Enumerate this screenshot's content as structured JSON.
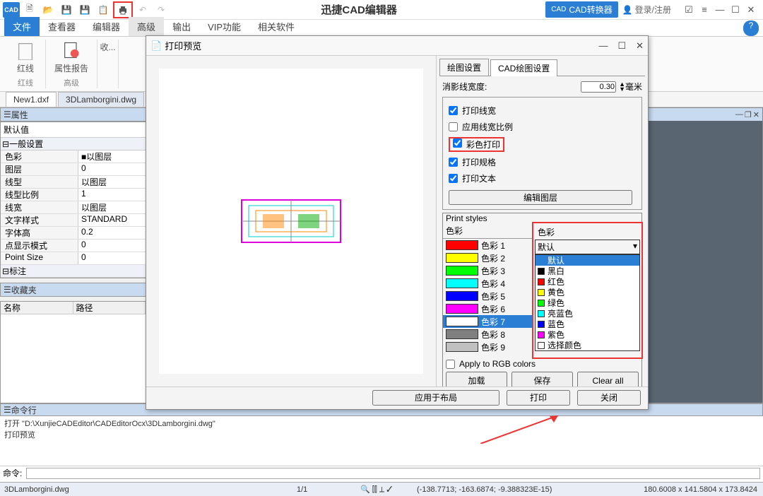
{
  "app": {
    "title": "迅捷CAD编辑器",
    "cad_converter": "CAD转换器",
    "login": "登录/注册"
  },
  "menutabs": [
    "文件",
    "查看器",
    "编辑器",
    "高级",
    "输出",
    "VIP功能",
    "相关软件"
  ],
  "ribbon": {
    "g1": {
      "label": "红线",
      "cat": "红线"
    },
    "g2": {
      "label": "属性报告",
      "cat": "高级"
    },
    "g3": {
      "label": "收..."
    }
  },
  "filetabs": [
    "New1.dxf",
    "3DLamborgini.dwg"
  ],
  "prop": {
    "title": "属性",
    "default": "默认值",
    "section1": "一般设置",
    "rows": [
      {
        "k": "色彩",
        "v": "■以图层"
      },
      {
        "k": "图层",
        "v": "0"
      },
      {
        "k": "线型",
        "v": "以图层"
      },
      {
        "k": "线型比例",
        "v": "1"
      },
      {
        "k": "线宽",
        "v": "以图层"
      },
      {
        "k": "文字样式",
        "v": "STANDARD"
      },
      {
        "k": "字体高",
        "v": "0.2"
      },
      {
        "k": "点显示模式",
        "v": "0"
      },
      {
        "k": "Point Size",
        "v": "0"
      }
    ],
    "section2": "标注"
  },
  "fav": {
    "title": "收藏夹",
    "cols": [
      "名称",
      "路径"
    ]
  },
  "cmd": {
    "title": "命令行",
    "line1": "打开 \"D:\\XunjieCADEditor\\CADEditorOcx\\3DLamborgini.dwg\"",
    "line2": "打印预览",
    "prompt": "命令:"
  },
  "status": {
    "file": "3DLamborgini.dwg",
    "pages": "1/1",
    "coords": "(-138.7713; -163.6874; -9.388323E-15)",
    "dims": "180.6008 x 141.5804 x 173.8424"
  },
  "dialog": {
    "title": "打印预览",
    "tabs": [
      "绘图设置",
      "CAD绘图设置"
    ],
    "hid_width_label": "消影线宽度:",
    "hid_width_val": "0.30",
    "hid_width_unit": "毫米",
    "opts": {
      "print_lw": "打印线宽",
      "apply_ratio": "应用线宽比例",
      "color_print": "彩色打印",
      "print_spec": "打印规格",
      "print_text": "打印文本"
    },
    "edit_layer": "编辑图层",
    "ps": {
      "title": "Print styles",
      "left_hdr": "色彩",
      "items": [
        {
          "name": "色彩 1",
          "c": "#ff0000"
        },
        {
          "name": "色彩 2",
          "c": "#ffff00"
        },
        {
          "name": "色彩 3",
          "c": "#00ff00"
        },
        {
          "name": "色彩 4",
          "c": "#00ffff"
        },
        {
          "name": "色彩 5",
          "c": "#0000ff"
        },
        {
          "name": "色彩 6",
          "c": "#ff00ff"
        },
        {
          "name": "色彩 7",
          "c": "#ffffff",
          "sel": true
        },
        {
          "name": "色彩 8",
          "c": "#808080"
        },
        {
          "name": "色彩 9",
          "c": "#c0c0c0"
        }
      ],
      "right_hdr": "色彩",
      "selected": "默认",
      "dropdown": [
        {
          "name": "默认",
          "c": null,
          "sel": true
        },
        {
          "name": "黑白",
          "c": "#000000"
        },
        {
          "name": "红色",
          "c": "#ff0000"
        },
        {
          "name": "黄色",
          "c": "#ffff00"
        },
        {
          "name": "绿色",
          "c": "#00ff00"
        },
        {
          "name": "亮蓝色",
          "c": "#00ffff"
        },
        {
          "name": "蓝色",
          "c": "#0000ff"
        },
        {
          "name": "紫色",
          "c": "#ff00ff"
        },
        {
          "name": "选择颜色",
          "c": "#ffffff"
        }
      ],
      "apply_rgb": "Apply to RGB colors"
    },
    "btns": {
      "load": "加载",
      "save": "保存",
      "clear": "Clear all"
    },
    "footer": {
      "layout": "应用于布局",
      "print": "打印",
      "close": "关闭"
    }
  }
}
